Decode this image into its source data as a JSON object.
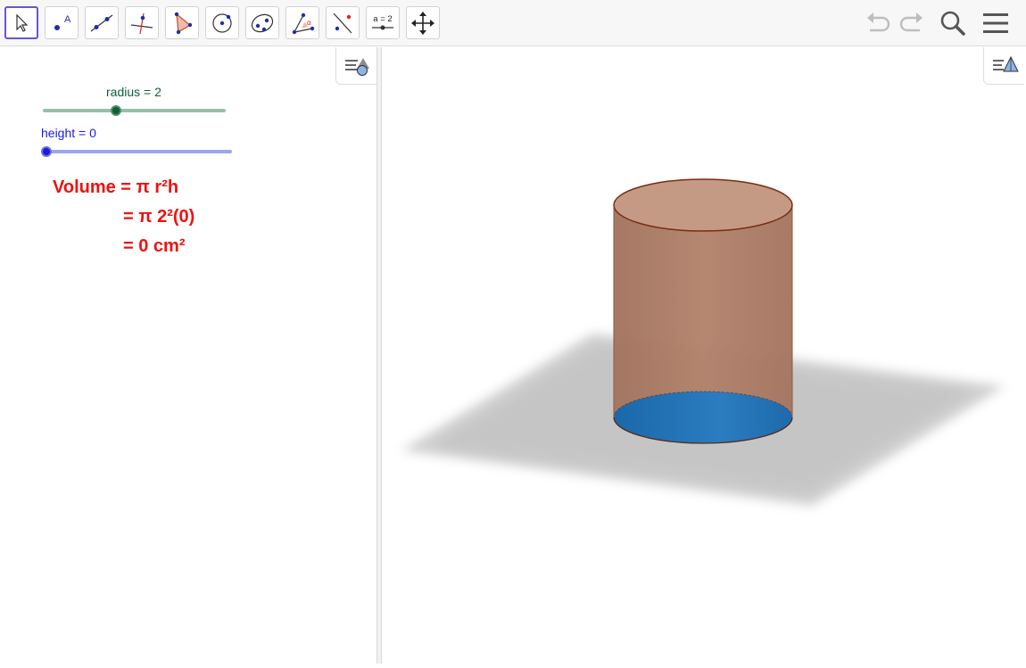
{
  "toolbar": {
    "tools": [
      {
        "name": "move-tool",
        "icon": "cursor-arrow-icon"
      },
      {
        "name": "point-tool",
        "icon": "point-with-label-icon",
        "label": "A"
      },
      {
        "name": "line-tool",
        "icon": "line-through-points-icon"
      },
      {
        "name": "perpendicular-line-tool",
        "icon": "perpendicular-line-icon"
      },
      {
        "name": "polygon-tool",
        "icon": "polygon-icon"
      },
      {
        "name": "circle-tool",
        "icon": "circle-center-point-icon"
      },
      {
        "name": "ellipse-tool",
        "icon": "conic-ellipse-icon"
      },
      {
        "name": "angle-tool",
        "icon": "angle-icon",
        "label": "α"
      },
      {
        "name": "reflect-tool",
        "icon": "reflect-about-line-icon"
      },
      {
        "name": "slider-tool",
        "icon": "slider-icon",
        "label": "a = 2"
      },
      {
        "name": "move-graphics-view-tool",
        "icon": "move-arrows-icon"
      }
    ],
    "active_tool": "move-tool"
  },
  "sliders": [
    {
      "label": "radius = 2",
      "value": 2,
      "min": 0,
      "max": 5,
      "color": "#0d5f36",
      "track_color": "#96bfa9"
    },
    {
      "label": "height = 0",
      "value": 0,
      "min": 0,
      "max": 5,
      "color": "#1a1ae6",
      "track_color": "#9aa6ef"
    }
  ],
  "formula": {
    "line1": "Volume = π r²h",
    "line2": "= π 2²(0)",
    "line3": "= 0 cm²",
    "color": "#ee1111"
  },
  "colors": {
    "accent": "#6557d2",
    "cylinder_side": "#a97760",
    "cylinder_top": "#c49a84",
    "cylinder_base": "#1f6fb2",
    "cylinder_edge": "#7a2c12"
  }
}
